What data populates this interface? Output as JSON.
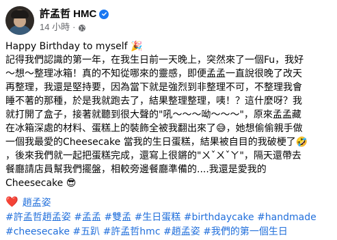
{
  "post": {
    "author": "許孟哲 HMC",
    "time": "14 小時",
    "separator": "·",
    "lines": [
      "Happy Birthday to myself 🎉",
      "記得我們認識的第一年，在我生日前一天晚上，突然來了一個Fu，我好",
      "～想～整理冰箱！真的不知從哪來的靈感，即便孟孟一直說很晚了改天",
      "再整理，我還是堅持要，因為當下就是強烈到非整理不可，不整理我會",
      "睡不著的那種，於是我就跑去了，結果整理整理，咦！？這什麼呀？我",
      "就打開了盒子，接著就聽到很大聲的\"吼～～～呦～～～\"，原來孟孟藏",
      "在冰箱深處的材料、蛋糕上的裝飾全被我翻出來了😅，她想偷偷親手做",
      "一個我最愛的Cheesecake 當我的生日蛋糕，結果被自目的我破梗了🤣",
      "，後來我們就一起把蛋糕完成，還寫上很鏘的\"ㄨˇㄨˇㄚ\"，隔天還帶去",
      "餐廳請店員幫我們擺盤，相較旁邊餐廳準備的....我還是愛我的",
      "Cheesecake 😎"
    ],
    "mention_heart": "❤️",
    "mention": "趙孟姿",
    "tag_lines": [
      [
        "#許孟哲趙孟姿",
        "#孟孟",
        "#雙孟",
        "#生日蛋糕",
        "#birthdaycake",
        "#handmade"
      ],
      [
        "#cheesecake",
        "#五趴",
        "#許孟哲hmc",
        "#趙孟姿",
        "#我們的第一個生日"
      ]
    ]
  },
  "colors": {
    "link": "#216fdb",
    "verified": "#1877f2",
    "secondary_text": "#65676b"
  },
  "icons": {
    "verified": "verified-badge-icon",
    "audience": "globe-icon"
  }
}
